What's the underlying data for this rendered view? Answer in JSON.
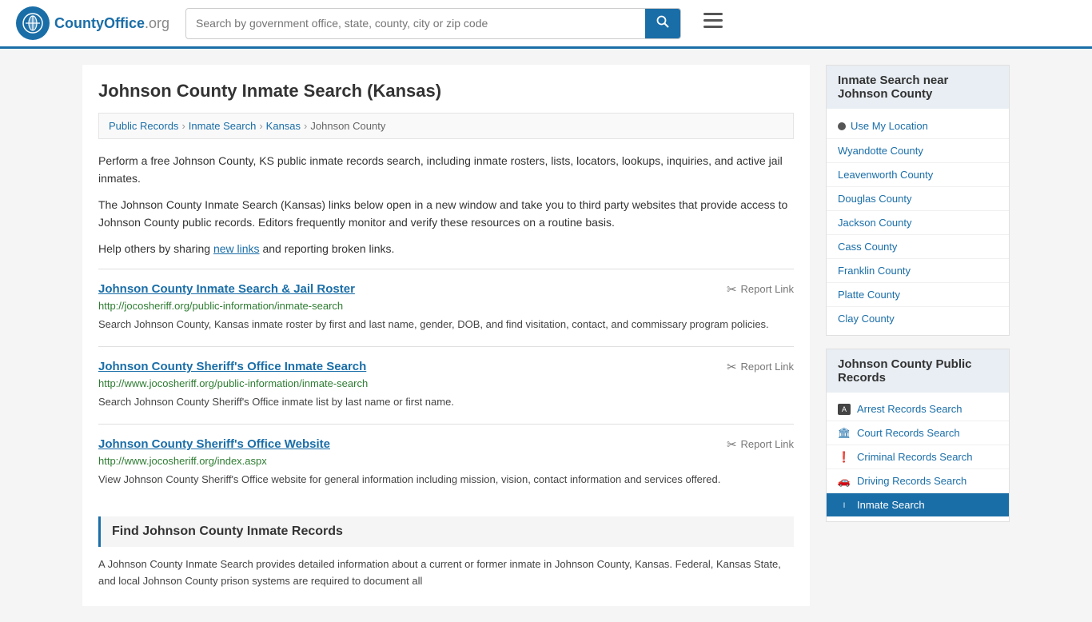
{
  "header": {
    "logo_text": "CountyOffice",
    "logo_suffix": ".org",
    "search_placeholder": "Search by government office, state, county, city or zip code"
  },
  "page": {
    "title": "Johnson County Inmate Search (Kansas)",
    "breadcrumb": [
      {
        "label": "Public Records",
        "href": "#"
      },
      {
        "label": "Inmate Search",
        "href": "#"
      },
      {
        "label": "Kansas",
        "href": "#"
      },
      {
        "label": "Johnson County",
        "href": "#"
      }
    ],
    "description1": "Perform a free Johnson County, KS public inmate records search, including inmate rosters, lists, locators, lookups, inquiries, and active jail inmates.",
    "description2": "The Johnson County Inmate Search (Kansas) links below open in a new window and take you to third party websites that provide access to Johnson County public records. Editors frequently monitor and verify these resources on a routine basis.",
    "description3_pre": "Help others by sharing ",
    "description3_link": "new links",
    "description3_post": " and reporting broken links.",
    "results": [
      {
        "title": "Johnson County Inmate Search & Jail Roster",
        "url": "http://jocosheriff.org/public-information/inmate-search",
        "desc": "Search Johnson County, Kansas inmate roster by first and last name, gender, DOB, and find visitation, contact, and commissary program policies."
      },
      {
        "title": "Johnson County Sheriff's Office Inmate Search",
        "url": "http://www.jocosheriff.org/public-information/inmate-search",
        "desc": "Search Johnson County Sheriff's Office inmate list by last name or first name."
      },
      {
        "title": "Johnson County Sheriff's Office Website",
        "url": "http://www.jocosheriff.org/index.aspx",
        "desc": "View Johnson County Sheriff's Office website for general information including mission, vision, contact information and services offered."
      }
    ],
    "report_label": "Report Link",
    "section_heading": "Find Johnson County Inmate Records",
    "section_desc": "A Johnson County Inmate Search provides detailed information about a current or former inmate in Johnson County, Kansas. Federal, Kansas State, and local Johnson County prison systems are required to document all"
  },
  "sidebar": {
    "nearby_title": "Inmate Search near Johnson County",
    "use_location": "Use My Location",
    "nearby_counties": [
      "Wyandotte County",
      "Leavenworth County",
      "Douglas County",
      "Jackson County",
      "Cass County",
      "Franklin County",
      "Platte County",
      "Clay County"
    ],
    "public_records_title": "Johnson County Public Records",
    "public_records_links": [
      {
        "label": "Arrest Records Search",
        "icon": "arrest"
      },
      {
        "label": "Court Records Search",
        "icon": "court"
      },
      {
        "label": "Criminal Records Search",
        "icon": "criminal"
      },
      {
        "label": "Driving Records Search",
        "icon": "driving"
      },
      {
        "label": "Inmate Search",
        "icon": "inmate",
        "active": true
      }
    ]
  }
}
